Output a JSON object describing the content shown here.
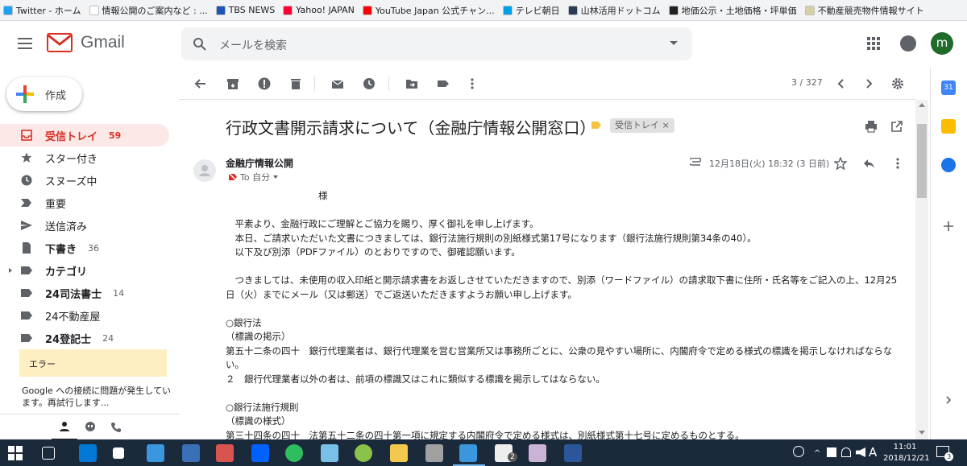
{
  "bookmarks": [
    {
      "label": "Twitter - ホーム",
      "color": "#1da1f2"
    },
    {
      "label": "情報公開のご案内など : ...",
      "color": "#ffffff"
    },
    {
      "label": "TBS NEWS",
      "color": "#1a56b8"
    },
    {
      "label": "Yahoo! JAPAN",
      "color": "#ff0033"
    },
    {
      "label": "YouTube Japan 公式チャン...",
      "color": "#ff0000"
    },
    {
      "label": "テレビ朝日",
      "color": "#00a0e9"
    },
    {
      "label": "山林活用ドットコム",
      "color": "#2b3a55"
    },
    {
      "label": "地価公示・土地価格・坪単価",
      "color": "#222222"
    },
    {
      "label": "不動産競売物件情報サイト",
      "color": "#d6cfa2"
    }
  ],
  "header": {
    "app_name": "Gmail",
    "search_placeholder": "メールを検索",
    "avatar_letter": "m",
    "avatar_color": "#1e6b2a"
  },
  "sidebar": {
    "compose_label": "作成",
    "items": [
      {
        "label": "受信トレイ",
        "count": "59",
        "icon": "inbox-icon",
        "active": true
      },
      {
        "label": "スター付き",
        "count": "",
        "icon": "star-icon"
      },
      {
        "label": "スヌーズ中",
        "count": "",
        "icon": "clock-icon"
      },
      {
        "label": "重要",
        "count": "",
        "icon": "important-icon"
      },
      {
        "label": "送信済み",
        "count": "",
        "icon": "send-icon"
      },
      {
        "label": "下書き",
        "count": "36",
        "icon": "draft-icon",
        "bold": true
      },
      {
        "label": "カテゴリ",
        "count": "",
        "icon": "label-icon",
        "bold": true,
        "expandable": true
      },
      {
        "label": "24司法書士",
        "count": "14",
        "icon": "label-icon",
        "bold": true
      },
      {
        "label": "24不動産屋",
        "count": "",
        "icon": "label-icon"
      },
      {
        "label": "24登記士",
        "count": "24",
        "icon": "label-icon",
        "bold": true
      }
    ],
    "error_title": "エラー",
    "error_message": "Google への接続に問題が発生しています。再試行します..."
  },
  "toolbar": {
    "page_count": "3 / 327"
  },
  "mail": {
    "subject": "行政文書開示請求について（金融庁情報公開窓口）",
    "label_chip": "受信トレイ ×",
    "sender": "金融庁情報公開",
    "to": "To 自分",
    "date": "12月18日(火) 18:32 (3 日前)",
    "body": [
      "　　　　　　　　　　様",
      "",
      "　平素より、金融行政にご理解とご協力を賜り、厚く御礼を申し上げます。",
      "　本日、ご請求いただいた文書につきましては、銀行法施行規則の別紙様式第17号になります（銀行法施行規則第34条の40）。",
      "　以下及び別添（PDFファイル）のとおりですので、御確認願います。",
      "",
      "　つきましては、未使用の収入印紙と開示請求書をお返しさせていただきますので、別添（ワードファイル）の請求取下書に住所・氏名等をご記入の上、12月25日（火）までにメール（又は郵送）でご返送いただきますようお願い申し上げます。",
      "",
      "○銀行法",
      "（標識の掲示）",
      "第五十二条の四十　銀行代理業者は、銀行代理業を営む営業所又は事務所ごとに、公衆の見やすい場所に、内閣府令で定める様式の標識を掲示しなければならない。",
      "２　銀行代理業者以外の者は、前項の標識又はこれに類似する標識を掲示してはならない。",
      "",
      "○銀行法施行規則",
      "（標識の様式）",
      "第三十四条の四十　法第五十二条の四十第一項に規定する内閣府令で定める様式は、別紙様式第十七号に定めるものとする。"
    ]
  },
  "taskbar": {
    "time": "11:01",
    "date": "2018/12/21",
    "ime": "A",
    "notifications": "3",
    "mail_badge": "2"
  }
}
